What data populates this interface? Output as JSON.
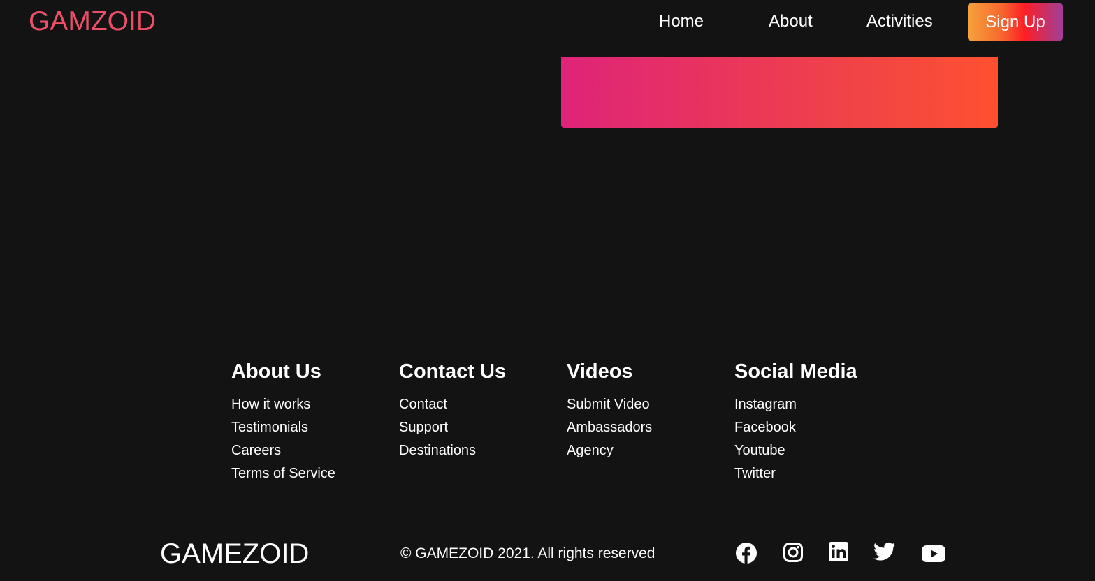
{
  "navbar": {
    "logo": "GAMZOID",
    "links": [
      {
        "label": "Home"
      },
      {
        "label": "About"
      },
      {
        "label": "Activities"
      }
    ],
    "signup_label": "Sign Up"
  },
  "footer": {
    "columns": [
      {
        "title": "About Us",
        "links": [
          "How it works",
          "Testimonials",
          "Careers",
          "Terms of Service"
        ]
      },
      {
        "title": "Contact Us",
        "links": [
          "Contact",
          "Support",
          "Destinations"
        ]
      },
      {
        "title": "Videos",
        "links": [
          "Submit Video",
          "Ambassadors",
          "Agency"
        ]
      },
      {
        "title": "Social Media",
        "links": [
          "Instagram",
          "Facebook",
          "Youtube",
          "Twitter"
        ]
      }
    ],
    "brand": "GAMEZOID",
    "copyright": "© GAMEZOID 2021. All rights reserved",
    "social_icons": [
      "facebook-icon",
      "instagram-icon",
      "linkedin-icon",
      "twitter-icon",
      "youtube-icon"
    ]
  },
  "colors": {
    "background": "#131313",
    "logo": "#ee4f68",
    "text": "#ffffff"
  }
}
